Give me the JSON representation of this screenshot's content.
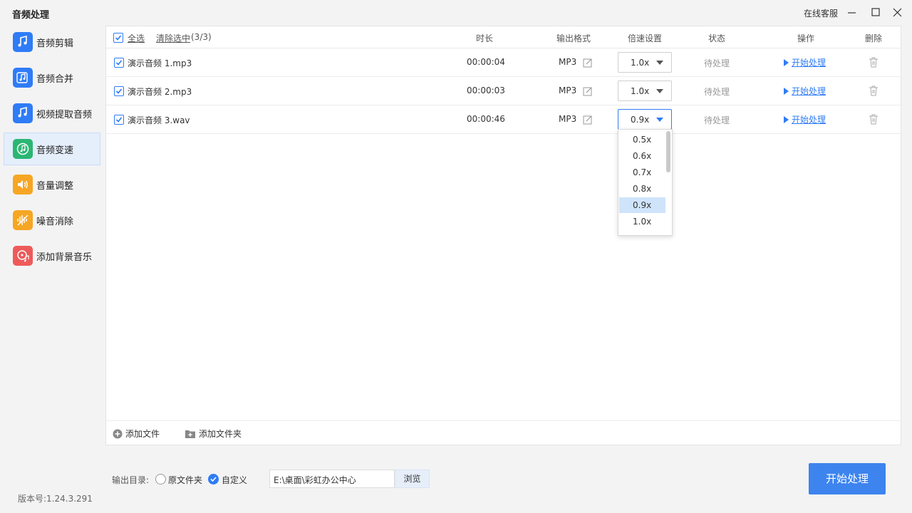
{
  "window": {
    "title": "音频处理",
    "online_service": "在线客服"
  },
  "sidebar": {
    "items": [
      {
        "label": "音频剪辑",
        "icon": "scissors-music-icon",
        "color": "#2f7cf6"
      },
      {
        "label": "音频合并",
        "icon": "merge-music-icon",
        "color": "#2f7cf6"
      },
      {
        "label": "视频提取音频",
        "icon": "video-extract-icon",
        "color": "#2f7cf6"
      },
      {
        "label": "音频变速",
        "icon": "speed-music-icon",
        "color": "#2bb673",
        "active": true
      },
      {
        "label": "音量调整",
        "icon": "volume-icon",
        "color": "#f6a623"
      },
      {
        "label": "噪音消除",
        "icon": "noise-wave-icon",
        "color": "#f6a623"
      },
      {
        "label": "添加背景音乐",
        "icon": "bg-music-icon",
        "color": "#ee5a5a"
      }
    ]
  },
  "table": {
    "select_all": "全选",
    "clear_selection": "清除选中",
    "selection_count": "(3/3)",
    "headers": {
      "duration": "时长",
      "format": "输出格式",
      "speed": "倍速设置",
      "status": "状态",
      "action": "操作",
      "delete": "删除"
    },
    "rows": [
      {
        "name": "演示音频 1.mp3",
        "duration": "00:00:04",
        "format": "MP3",
        "speed": "1.0x",
        "status": "待处理",
        "action": "开始处理"
      },
      {
        "name": "演示音频 2.mp3",
        "duration": "00:00:03",
        "format": "MP3",
        "speed": "1.0x",
        "status": "待处理",
        "action": "开始处理"
      },
      {
        "name": "演示音频 3.wav",
        "duration": "00:00:46",
        "format": "MP3",
        "speed": "0.9x",
        "status": "待处理",
        "action": "开始处理"
      }
    ],
    "speed_options": [
      "0.5x",
      "0.6x",
      "0.7x",
      "0.8x",
      "0.9x",
      "1.0x"
    ],
    "speed_selected": "0.9x"
  },
  "footer": {
    "add_file": "添加文件",
    "add_folder": "添加文件夹"
  },
  "output": {
    "label": "输出目录:",
    "option_original": "原文件夹",
    "option_custom": "自定义",
    "path": "E:\\桌面\\彩虹办公中心",
    "browse": "浏览",
    "start": "开始处理"
  },
  "version": "版本号:1.24.3.291",
  "colors": {
    "accent": "#2f7cf6",
    "primary_button": "#3d84ee"
  }
}
